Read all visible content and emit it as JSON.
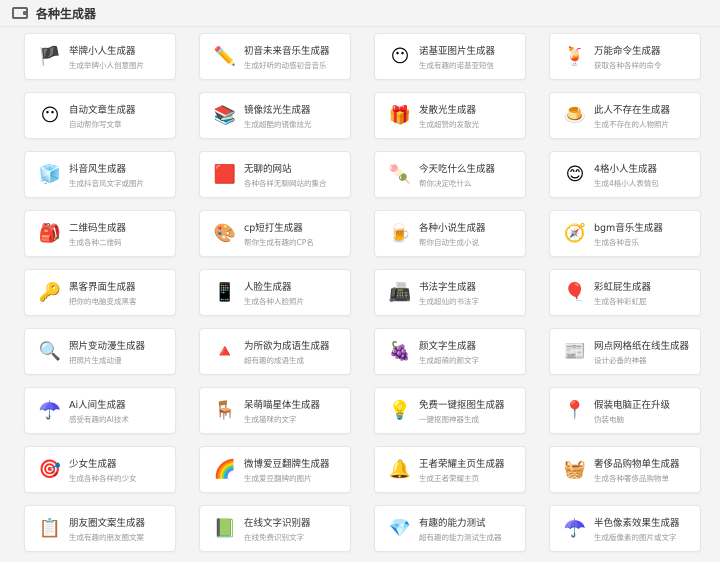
{
  "header": {
    "title": "各种生成器",
    "icon": "wallet-icon"
  },
  "items": [
    {
      "name": "举牌小人生成器",
      "desc": "生成举牌小人创意图片",
      "icon": "🏴",
      "icon_name": "sign-holder-icon"
    },
    {
      "name": "初音未来音乐生成器",
      "desc": "生成好听的动感初音音乐",
      "icon": "✏️",
      "icon_name": "pencil-icon"
    },
    {
      "name": "诺基亚图片生成器",
      "desc": "生成有趣的诺基亚短信",
      "icon": "😶",
      "icon_name": "face-icon"
    },
    {
      "name": "万能命令生成器",
      "desc": "获取各种各样的命令",
      "icon": "🍹",
      "icon_name": "drink-icon"
    },
    {
      "name": "自动文章生成器",
      "desc": "自动帮你写文章",
      "icon": "😶",
      "icon_name": "face-icon"
    },
    {
      "name": "镜像炫光生成器",
      "desc": "生成超酷的镜像炫光",
      "icon": "📚",
      "icon_name": "books-icon"
    },
    {
      "name": "发散光生成器",
      "desc": "生成超赞的发散光",
      "icon": "🎁",
      "icon_name": "gift-box-icon"
    },
    {
      "name": "此人不存在生成器",
      "desc": "生成不存在的人物照片",
      "icon": "🍮",
      "icon_name": "pudding-icon"
    },
    {
      "name": "抖音风生成器",
      "desc": "生成抖音风文字或图片",
      "icon": "🧊",
      "icon_name": "cubes-icon"
    },
    {
      "name": "无聊的网站",
      "desc": "各种各样无聊网站的集合",
      "icon": "🟥",
      "icon_name": "pink-card-icon"
    },
    {
      "name": "今天吃什么生成器",
      "desc": "帮你决定吃什么",
      "icon": "🍡",
      "icon_name": "popsicle-icon"
    },
    {
      "name": "4格小人生成器",
      "desc": "生成4格小人表情包",
      "icon": "😊",
      "icon_name": "smiley-icon"
    },
    {
      "name": "二维码生成器",
      "desc": "生成各种二维码",
      "icon": "🎒",
      "icon_name": "backpack-icon"
    },
    {
      "name": "cp短打生成器",
      "desc": "帮你生成有趣的CP名",
      "icon": "🎨",
      "icon_name": "paint-icon"
    },
    {
      "name": "各种小说生成器",
      "desc": "帮你自动生成小说",
      "icon": "🍺",
      "icon_name": "mug-icon"
    },
    {
      "name": "bgm音乐生成器",
      "desc": "生成各种音乐",
      "icon": "🧭",
      "icon_name": "compass-icon"
    },
    {
      "name": "黑客界面生成器",
      "desc": "把你的电脑变成黑客",
      "icon": "🔑",
      "icon_name": "key-icon"
    },
    {
      "name": "人脸生成器",
      "desc": "生成各种人脸照片",
      "icon": "📱",
      "icon_name": "phone-icon"
    },
    {
      "name": "书法字生成器",
      "desc": "生成超仙的书法字",
      "icon": "📠",
      "icon_name": "cash-register-icon"
    },
    {
      "name": "彩虹屁生成器",
      "desc": "生成各种彩虹屁",
      "icon": "🎈",
      "icon_name": "balloon-icon"
    },
    {
      "name": "照片变动漫生成器",
      "desc": "把照片生成动漫",
      "icon": "🔍",
      "icon_name": "magnifier-icon"
    },
    {
      "name": "为所欲为成语生成器",
      "desc": "超有趣的成语生成",
      "icon": "🔺",
      "icon_name": "triangle-icon"
    },
    {
      "name": "颜文字生成器",
      "desc": "生成超萌的颜文字",
      "icon": "🍇",
      "icon_name": "grapes-icon"
    },
    {
      "name": "网点网格纸在线生成器",
      "desc": "设计必备的神器",
      "icon": "📰",
      "icon_name": "newspaper-icon"
    },
    {
      "name": "Ai人间生成器",
      "desc": "感受有趣的AI技术",
      "icon": "☂️",
      "icon_name": "umbrella-icon"
    },
    {
      "name": "呆萌喵星体生成器",
      "desc": "生成猫咪的文字",
      "icon": "🪑",
      "icon_name": "chair-icon"
    },
    {
      "name": "免费一键抠图生成器",
      "desc": "一键抠图神器生成",
      "icon": "💡",
      "icon_name": "lightbulb-icon"
    },
    {
      "name": "假装电脑正在升级",
      "desc": "伪装电脑",
      "icon": "📍",
      "icon_name": "location-pin-icon"
    },
    {
      "name": "少女生成器",
      "desc": "生成各种各样的少女",
      "icon": "🎯",
      "icon_name": "target-icon"
    },
    {
      "name": "微博爱豆翻牌生成器",
      "desc": "生成爱豆翻牌的图片",
      "icon": "🌈",
      "icon_name": "rainbow-icon"
    },
    {
      "name": "王者荣耀主页生成器",
      "desc": "生成王者荣耀主页",
      "icon": "🔔",
      "icon_name": "bell-icon"
    },
    {
      "name": "奢侈品购物单生成器",
      "desc": "生成各种奢侈品购物单",
      "icon": "🧺",
      "icon_name": "basket-icon"
    },
    {
      "name": "朋友圈文案生成器",
      "desc": "生成有趣的朋友圈文案",
      "icon": "📋",
      "icon_name": "clipboard-icon"
    },
    {
      "name": "在线文字识别器",
      "desc": "在线免费识别文字",
      "icon": "📗",
      "icon_name": "book-icon"
    },
    {
      "name": "有趣的能力测试",
      "desc": "超有趣的能力测试生成器",
      "icon": "💎",
      "icon_name": "diamond-icon"
    },
    {
      "name": "半色像素效果生成器",
      "desc": "生成版像素的图片或文字",
      "icon": "☂️",
      "icon_name": "umbrella-icon"
    }
  ]
}
